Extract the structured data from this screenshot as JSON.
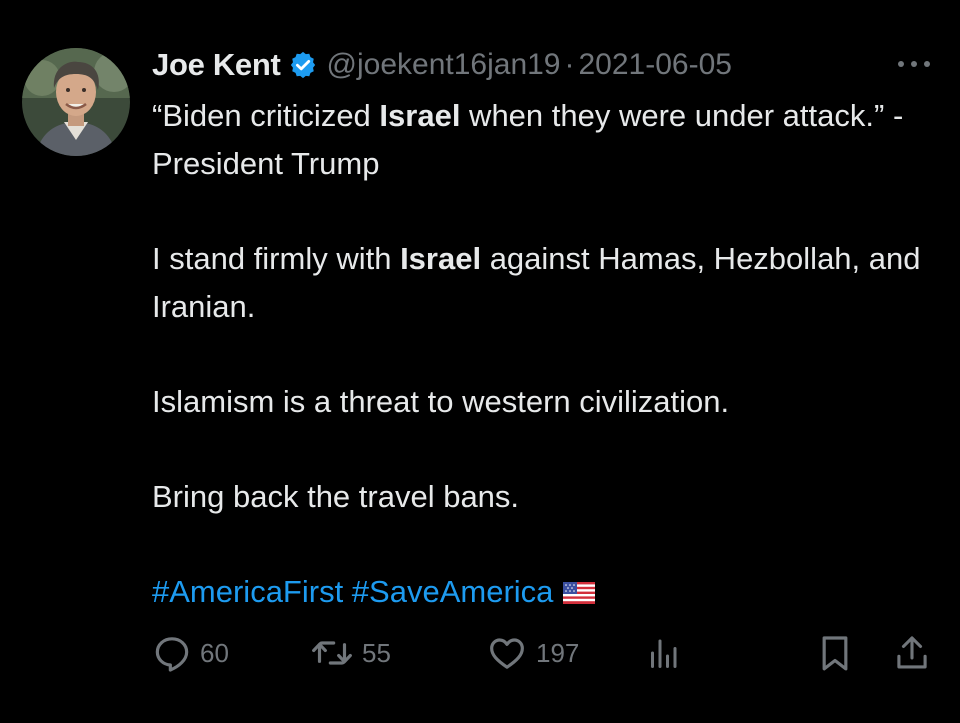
{
  "author": {
    "name": "Joe Kent",
    "handle": "@joekent16jan19",
    "separator": "·",
    "date": "2021-06-05",
    "verified": true
  },
  "tweet": {
    "p1_before": "“Biden criticized ",
    "p1_bold": "Israel",
    "p1_after": " when they were under attack.” - President Trump",
    "p2_before": "I stand firmly with ",
    "p2_bold": "Israel",
    "p2_after": " against Hamas, Hezbollah, and Iranian.",
    "p3": "Islamism is a threat to western civilization.",
    "p4": "Bring back the travel bans.",
    "hashtags": "#AmericaFirst #SaveAmerica",
    "flag_icon": "us-flag-icon"
  },
  "actions": {
    "replies": "60",
    "reposts": "55",
    "likes": "197"
  },
  "colors": {
    "background": "#000000",
    "text": "#e7e9ea",
    "muted": "#71767b",
    "link": "#1d9bf0",
    "verified": "#1d9bf0"
  }
}
